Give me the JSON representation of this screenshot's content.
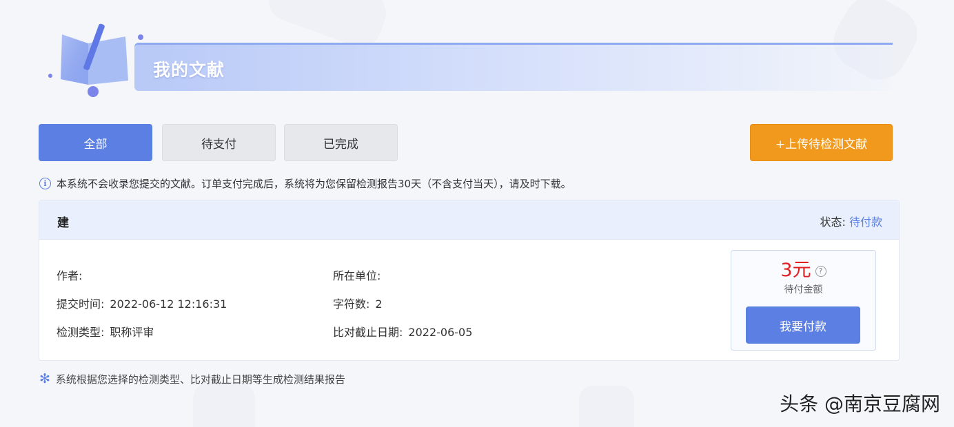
{
  "header": {
    "title": "我的文献"
  },
  "tabs": [
    {
      "label": "全部",
      "active": true
    },
    {
      "label": "待支付",
      "active": false
    },
    {
      "label": "已完成",
      "active": false
    }
  ],
  "upload_button": "+上传待检测文献",
  "notice": "本系统不会收录您提交的文献。订单支付完成后，系统将为您保留检测报告30天（不含支付当天），请及时下载。",
  "card": {
    "title": "建",
    "status_label": "状态:",
    "status_value": "待付款",
    "fields": {
      "author_label": "作者:",
      "author_value": "",
      "unit_label": "所在单位:",
      "unit_value": "",
      "submit_time_label": "提交时间:",
      "submit_time_value": "2022-06-12 12:16:31",
      "char_count_label": "字符数:",
      "char_count_value": "2",
      "check_type_label": "检测类型:",
      "check_type_value": "职称评审",
      "deadline_label": "比对截止日期:",
      "deadline_value": "2022-06-05"
    },
    "payment": {
      "amount": "3元",
      "amount_label": "待付金额",
      "pay_button": "我要付款"
    }
  },
  "footnote": "系统根据您选择的检测类型、比对截止日期等生成检测结果报告",
  "watermark": "头条 @南京豆腐网",
  "colors": {
    "primary": "#5b7fe3",
    "upload": "#f0991d",
    "amount": "#e02020"
  }
}
